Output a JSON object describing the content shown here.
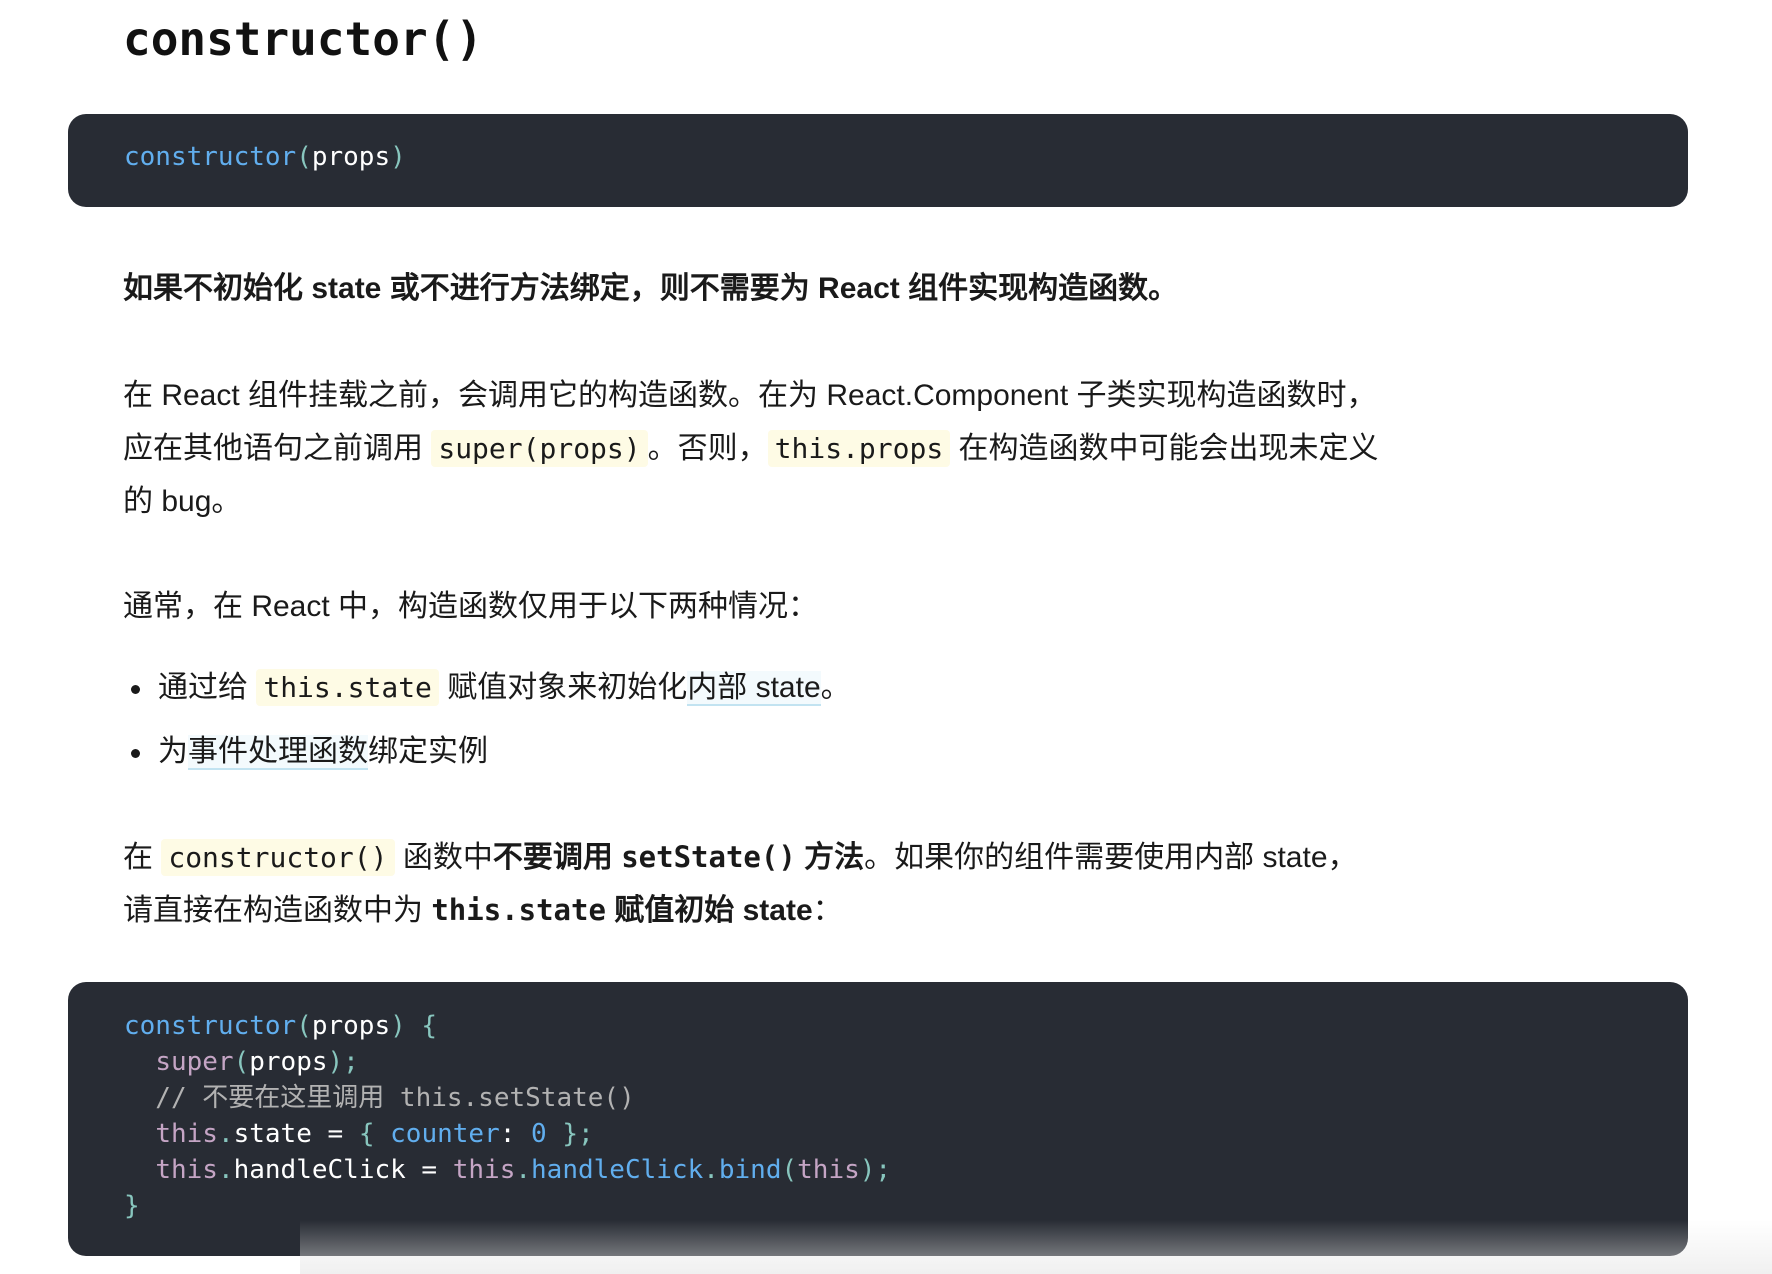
{
  "heading": "constructor()",
  "signature_code": {
    "fn": "constructor",
    "open": "(",
    "arg": "props",
    "close": ")"
  },
  "paragraph_1": "如果不初始化 state 或不进行方法绑定，则不需要为 React 组件实现构造函数。",
  "paragraph_2": {
    "line1": "在 React 组件挂载之前，会调用它的构造函数。在为 React.Component 子类实现构造函数时，",
    "line2_before": "应在其他语句之前调用 ",
    "code1": "super(props)",
    "line2_mid": "。否则，",
    "code2": "this.props",
    "line2_after": " 在构造函数中可能会出现未定义",
    "line3": "的 bug。"
  },
  "paragraph_3": "通常，在 React 中，构造函数仅用于以下两种情况：",
  "bullets": {
    "item1_before": "通过给 ",
    "item1_code": "this.state",
    "item1_mid": " 赋值对象来初始化",
    "item1_link": "内部 state",
    "item1_after": "。",
    "item2_before": "为",
    "item2_link": "事件处理函数",
    "item2_after": "绑定实例"
  },
  "paragraph_4": {
    "before": "在 ",
    "code": "constructor()",
    "mid1": " 函数中",
    "bold1": "不要调用 ",
    "bold_code": "setState()",
    "bold2": " 方法",
    "after1": "。如果你的组件需要使用内部 state，",
    "line2_before": "请直接在构造函数中为 ",
    "line2_bold_code": "this.state",
    "line2_bold": " 赋值初始 state",
    "line2_after": "："
  },
  "code_example": {
    "l1_fn": "constructor",
    "l1_open": "(",
    "l1_arg": "props",
    "l1_close": ") {",
    "l2_indent": "  ",
    "l2_kw": "super",
    "l2_open": "(",
    "l2_arg": "props",
    "l2_close": ");",
    "l3": "  // 不要在这里调用 this.setState()",
    "l4_indent": "  ",
    "l4_this": "this",
    "l4_dot": ".",
    "l4_state": "state",
    "l4_eq": " = ",
    "l4_brace": "{ ",
    "l4_key": "counter",
    "l4_colon": ": ",
    "l4_val": "0",
    "l4_end": " };",
    "l5_indent": "  ",
    "l5_this": "this",
    "l5_dot": ".",
    "l5_name": "handleClick",
    "l5_eq": " = ",
    "l5_this2": "this",
    "l5_dot2": ".",
    "l5_method": "handleClick",
    "l5_dot3": ".",
    "l5_bind": "bind",
    "l5_open": "(",
    "l5_this3": "this",
    "l5_close": ");",
    "l6": "}"
  }
}
